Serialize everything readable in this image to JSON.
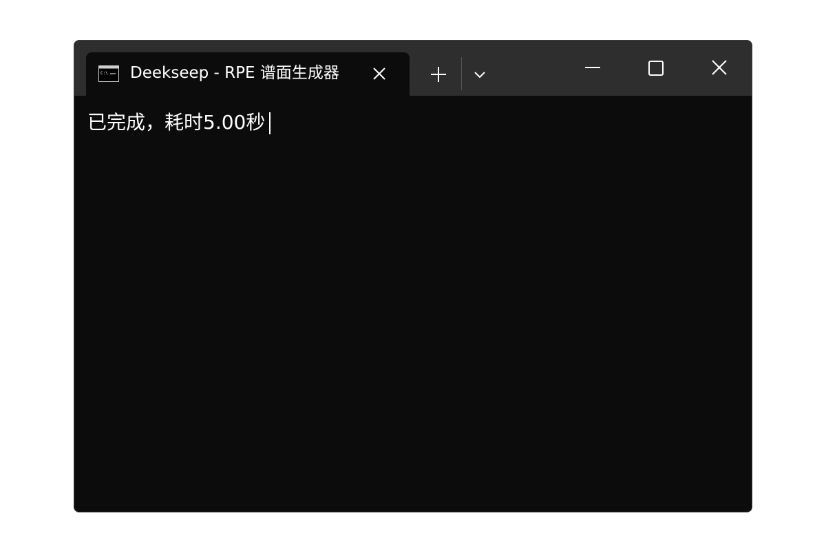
{
  "window": {
    "tab_title": "Deekseep - RPE 谱面生成器",
    "tab_icon": "cmd-prompt-icon",
    "icons": {
      "tab_close": "close-icon",
      "new_tab": "plus-icon",
      "dropdown": "chevron-down-icon",
      "minimize": "minimize-icon",
      "maximize": "maximize-icon",
      "close": "close-icon"
    }
  },
  "terminal": {
    "output": "已完成，耗时5.00秒"
  },
  "colors": {
    "terminal_bg": "#0c0c0c",
    "titlebar_bg": "#2e2e2e",
    "text": "#ffffff"
  }
}
